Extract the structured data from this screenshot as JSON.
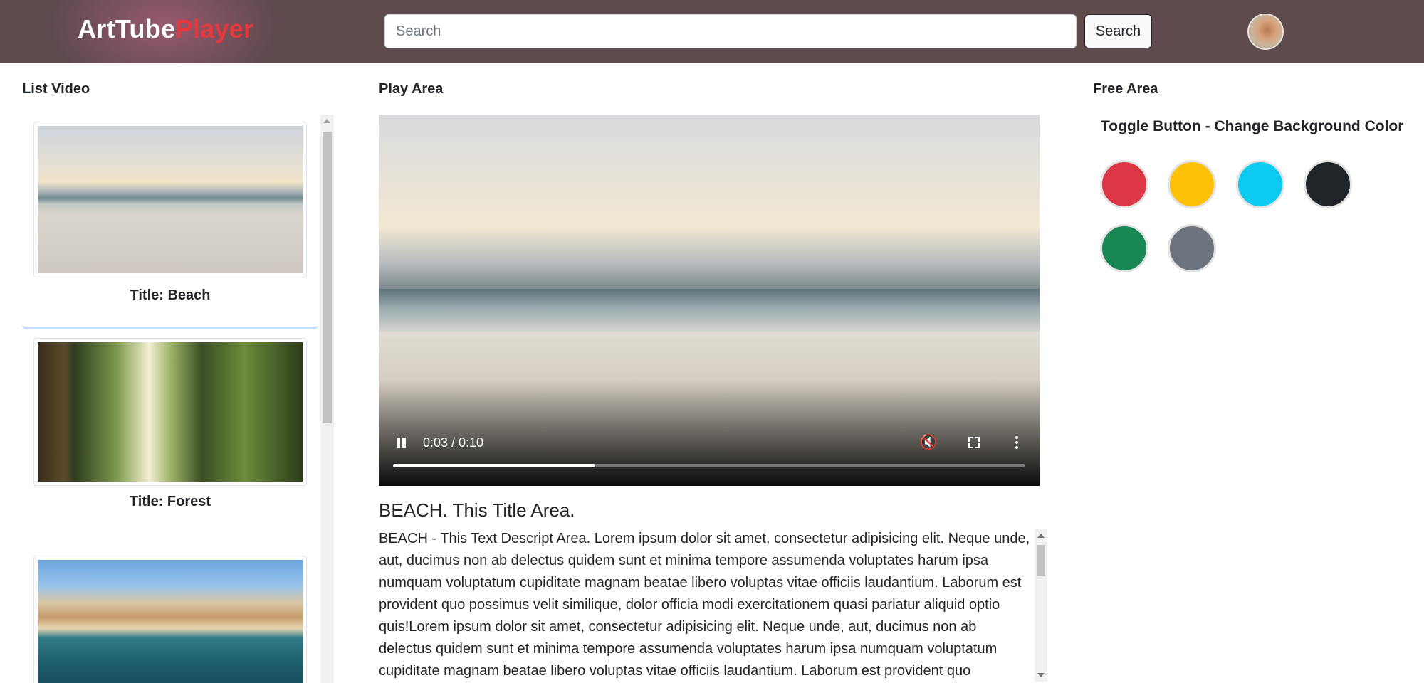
{
  "header": {
    "brand_main": "ArtTube",
    "brand_accent": "Player",
    "search_placeholder": "Search",
    "search_button": "Search"
  },
  "sections": {
    "list": "List Video",
    "play": "Play Area",
    "free": "Free Area"
  },
  "video_list": [
    {
      "title": "Title: Beach"
    },
    {
      "title": "Title: Forest"
    },
    {
      "title": ""
    }
  ],
  "player": {
    "time": "0:03 / 0:10",
    "progress": 0.32
  },
  "video": {
    "title": "BEACH. This Title Area.",
    "description": "BEACH - This Text Descript Area. Lorem ipsum dolor sit amet, consectetur adipisicing elit. Neque unde, aut, ducimus non ab delectus quidem sunt et minima tempore assumenda voluptates harum ipsa numquam voluptatum cupiditate magnam beatae libero voluptas vitae officiis laudantium. Laborum est provident quo possimus velit similique, dolor officia modi exercitationem quasi pariatur aliquid optio quis!Lorem ipsum dolor sit amet, consectetur adipisicing elit. Neque unde, aut, ducimus non ab delectus quidem sunt et minima tempore assumenda voluptates harum ipsa numquam voluptatum cupiditate magnam beatae libero voluptas vitae officiis laudantium. Laborum est provident quo possimus velit similique, dolor officia modi exercitationem quasi pariatur aliquid optio quis!"
  },
  "free_area": {
    "toggle_title": "Toggle Button - Change Background Color",
    "swatches": [
      {
        "name": "red",
        "color": "#dc3545"
      },
      {
        "name": "yellow",
        "color": "#ffc107"
      },
      {
        "name": "cyan",
        "color": "#0dcaf0"
      },
      {
        "name": "dark",
        "color": "#212529"
      },
      {
        "name": "green",
        "color": "#198754"
      },
      {
        "name": "gray",
        "color": "#6c757d"
      }
    ]
  },
  "icons": {
    "pause": "pause-icon",
    "volume": "volume-icon",
    "fullscreen": "fullscreen-icon",
    "more": "more-vertical-icon"
  }
}
